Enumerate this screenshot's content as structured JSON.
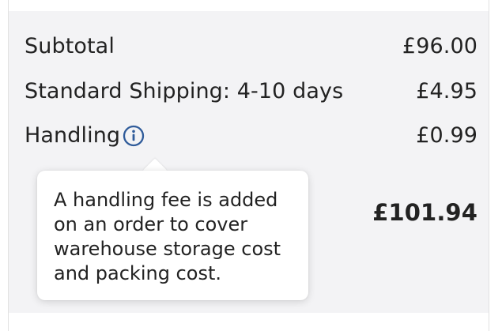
{
  "order_summary": {
    "subtotal": {
      "label": "Subtotal",
      "value": "£96.00"
    },
    "shipping": {
      "label": "Standard Shipping: 4-10 days",
      "value": "£4.95"
    },
    "handling": {
      "label": "Handling",
      "value": "£0.99",
      "icon": "info-icon"
    },
    "total": {
      "value": "£101.94"
    }
  },
  "tooltip": {
    "text": "A handling fee is added on an order to cover warehouse storage cost and packing cost."
  },
  "colors": {
    "panel_background": "#f3f3f5",
    "info_icon": "#2f5b9a",
    "text": "#222222",
    "tooltip_background": "#ffffff"
  }
}
